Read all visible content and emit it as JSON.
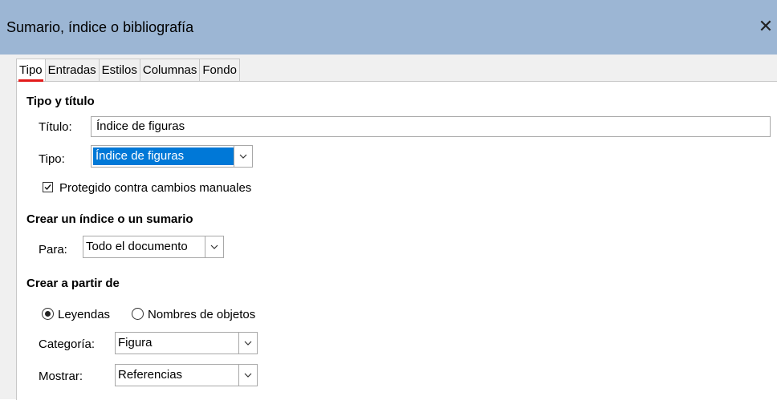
{
  "window": {
    "title": "Sumario, índice o bibliografía"
  },
  "tabs": [
    "Tipo",
    "Entradas",
    "Estilos",
    "Columnas",
    "Fondo"
  ],
  "type_section": {
    "heading": "Tipo y título",
    "title_label": "Título:",
    "title_value": "Índice de figuras",
    "type_label": "Tipo:",
    "type_value": "Índice de figuras",
    "protected_label": "Protegido contra cambios manuales",
    "protected_checked": true
  },
  "create_section": {
    "heading": "Crear un índice o un sumario",
    "for_label": "Para:",
    "for_value": "Todo el documento"
  },
  "from_section": {
    "heading": "Crear a partir de",
    "radio_captions": "Leyendas",
    "radio_object_names": "Nombres de objetos",
    "selected": "Leyendas",
    "category_label": "Categoría:",
    "category_value": "Figura",
    "display_label": "Mostrar:",
    "display_value": "Referencias"
  }
}
